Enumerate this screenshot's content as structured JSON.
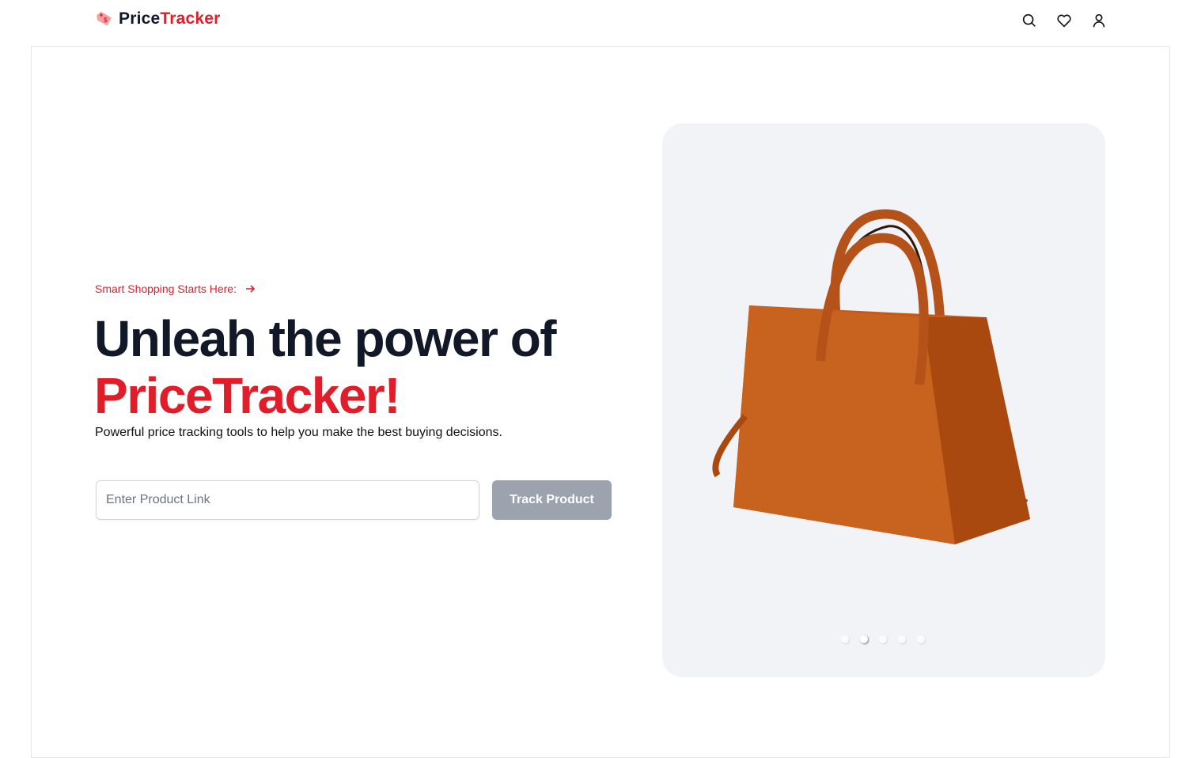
{
  "header": {
    "logo_part1": "Price",
    "logo_part2": "Tracker",
    "icons": [
      "search-icon",
      "heart-icon",
      "user-icon"
    ]
  },
  "hero": {
    "tagline": "Smart Shopping Starts Here:",
    "title_line1": "Unleah the power of",
    "title_line2": "PriceTracker!",
    "subtitle": "Powerful price tracking tools to help you make the best buying decisions.",
    "input_placeholder": "Enter Product Link",
    "button_label": "Track Product"
  },
  "carousel": {
    "slide_count": 5,
    "active_index": 1
  },
  "colors": {
    "accent": "#e11d2a",
    "button_disabled": "#9ca3af",
    "card_bg": "#f2f3f6"
  }
}
